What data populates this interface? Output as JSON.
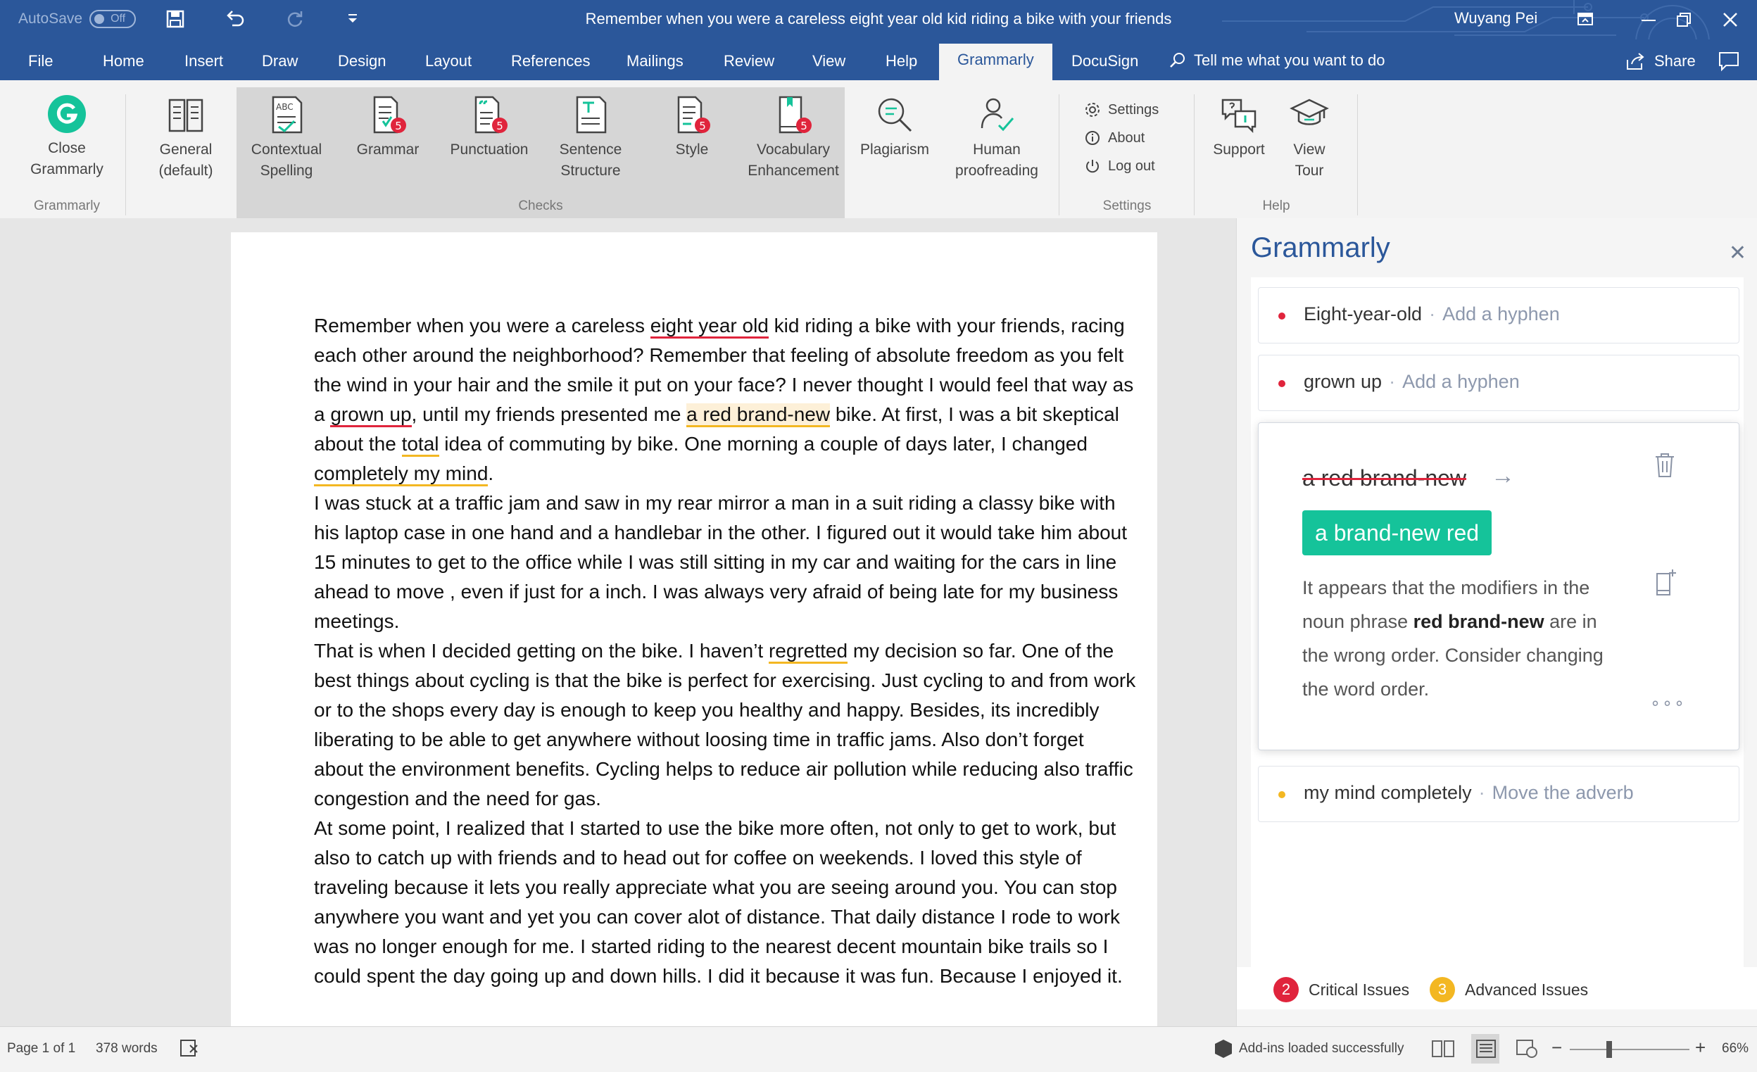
{
  "titlebar": {
    "autosave_label": "AutoSave",
    "autosave_state": "Off",
    "doc_title": "Remember when you were a careless eight year old kid riding a bike with your friends",
    "user_name": "Wuyang Pei"
  },
  "tabs": [
    "File",
    "Home",
    "Insert",
    "Draw",
    "Design",
    "Layout",
    "References",
    "Mailings",
    "Review",
    "View",
    "Help",
    "Grammarly",
    "DocuSign"
  ],
  "active_tab": "Grammarly",
  "tellme": "Tell me what you want to do",
  "share": "Share",
  "ribbon": {
    "close_grammarly": [
      "Close",
      "Grammarly"
    ],
    "grammarly_group": "Grammarly",
    "general": [
      "General",
      "(default)"
    ],
    "contextual": [
      "Contextual",
      "Spelling"
    ],
    "grammar": "Grammar",
    "punctuation": "Punctuation",
    "sentence": [
      "Sentence",
      "Structure"
    ],
    "style": "Style",
    "vocabulary": [
      "Vocabulary",
      "Enhancement"
    ],
    "checks_group": "Checks",
    "plagiarism": "Plagiarism",
    "human": [
      "Human",
      "proofreading"
    ],
    "settings": "Settings",
    "about": "About",
    "logout": "Log out",
    "settings_group": "Settings",
    "support": "Support",
    "viewtour": [
      "View",
      "Tour"
    ],
    "help_group": "Help",
    "badge_count": "5",
    "abc_label": "ABC"
  },
  "document": {
    "p1": [
      "Remember when you were a careless ",
      "eight year old",
      " kid riding a bike with your friends, racing each other around the neighborhood? Remember that feeling of absolute freedom as you felt the wind in your hair and the smile it put on your face? I never thought I would feel that way as a ",
      "grown up",
      ", until my friends presented me ",
      "a red brand-new",
      " bike. At first, I was a bit skeptical about the ",
      "total",
      " idea of commuting by bike. One morning a couple of days later, I changed ",
      "completely my mind",
      "."
    ],
    "p2": "I was stuck at a traffic jam and saw in my rear mirror a man in a suit riding a classy bike with his laptop case in one hand and a handlebar in the other. I figured out it would take him about 15 minutes to get to the office while I was still sitting in my car and waiting for the cars in line ahead to move , even if just for a inch. I was always very afraid of being late for my business meetings.",
    "p3": [
      "That is when I decided getting on the bike. I haven’t ",
      "regretted",
      " my decision so far. One of the best things about cycling is that the bike is perfect for exercising. Just cycling to and from work or to the shops every day is enough to keep you healthy and happy. Besides, its incredibly liberating to be able to get anywhere without loosing time in traffic jams. Also don’t forget about the environment benefits. Cycling helps to reduce air pollution while reducing also traffic congestion and the need for gas."
    ],
    "p4": "At some point, I realized that I started to use the bike more often, not only to get to work, but also to catch up with friends and to head out for coffee on weekends. I loved this style of traveling because it lets you really appreciate what you are seeing around you. You can stop anywhere you want and yet you can cover alot of distance. That daily distance I rode to work was no longer enough for me. I started riding to the nearest decent mountain bike trails so I could spent the day going up and down hills. I did it because it was fun. Because I enjoyed it."
  },
  "pane": {
    "title": "Grammarly",
    "cards": [
      {
        "word": "Eight-year-old",
        "hint": "Add a hyphen",
        "color": "#e0243c"
      },
      {
        "word": "grown up",
        "hint": "Add a hyphen",
        "color": "#e0243c"
      }
    ],
    "expanded": {
      "original": "a red brand-new",
      "suggestion": "a brand-new red",
      "explain_pre": "It appears that the modifiers in the noun phrase ",
      "explain_bold": "red brand-new",
      "explain_post": " are in the wrong order. Consider changing the word order."
    },
    "card4": {
      "word": "my mind completely",
      "hint": "Move the adverb",
      "color": "#f3b722"
    },
    "critical_count": "2",
    "critical_label": "Critical Issues",
    "advanced_count": "3",
    "advanced_label": "Advanced Issues"
  },
  "status": {
    "page": "Page 1 of 1",
    "words": "378 words",
    "addins": "Add-ins loaded successfully",
    "zoom": "66%"
  },
  "colors": {
    "word_blue": "#2b579a",
    "grammarly_green": "#15c39a",
    "critical": "#e0243c",
    "advanced": "#f3b722"
  }
}
